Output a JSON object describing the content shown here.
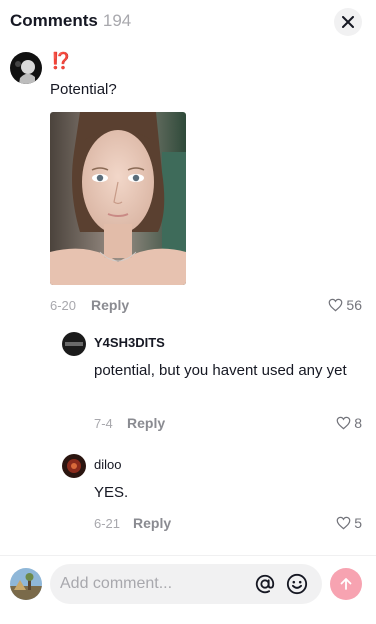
{
  "header": {
    "title": "Comments",
    "count": "194"
  },
  "comment": {
    "emoji": "⁉️",
    "text": "Potential?",
    "date": "6-20",
    "reply_label": "Reply",
    "likes": "56"
  },
  "replies": [
    {
      "username": "Y4SH3DITS",
      "text": "potential, but you havent used any yet",
      "date": "7-4",
      "reply_label": "Reply",
      "likes": "8"
    },
    {
      "username": "diloo",
      "text": "YES.",
      "date": "6-21",
      "reply_label": "Reply",
      "likes": "5"
    }
  ],
  "composer": {
    "placeholder": "Add comment..."
  },
  "colors": {
    "accent_send": "#f7a3b1",
    "emoji_red": "#ff3b3b",
    "input_bg": "#f1f1f2",
    "muted_text": "#a8a8ad"
  },
  "icons": [
    "close-icon",
    "heart-icon",
    "at-icon",
    "emoji-icon",
    "arrow-up-icon"
  ]
}
